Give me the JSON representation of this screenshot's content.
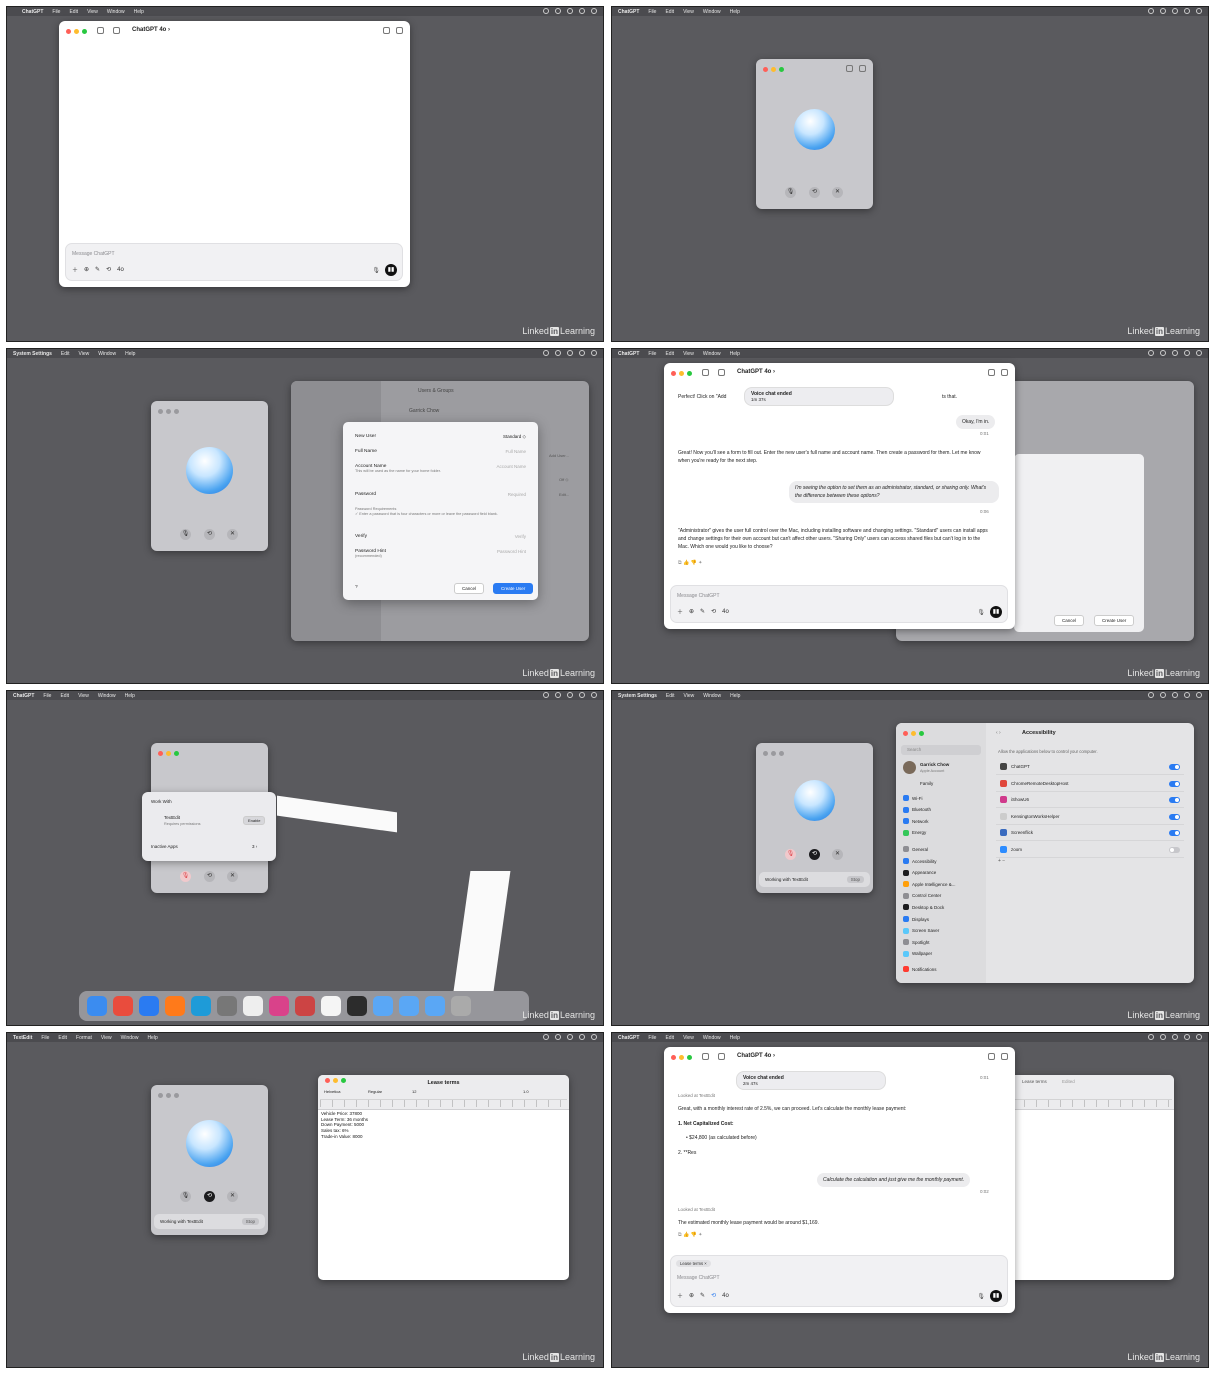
{
  "menubar": {
    "chatgpt": {
      "app": "ChatGPT",
      "items": [
        "File",
        "Edit",
        "View",
        "Window",
        "Help"
      ]
    },
    "settings": {
      "app": "System Settings",
      "items": [
        "Edit",
        "View",
        "Window",
        "Help"
      ]
    },
    "textedit": {
      "app": "TextEdit",
      "items": [
        "File",
        "Edit",
        "Format",
        "View",
        "Window",
        "Help"
      ]
    }
  },
  "watermark": {
    "brand": "Linked",
    "in": "in",
    "suffix": "Learning"
  },
  "chat": {
    "title": "ChatGPT 4o ›",
    "placeholder": "Message ChatGPT",
    "model_badge": "4o"
  },
  "frame4": {
    "toast_title": "Voice chat ended",
    "toast_time": "1m 37s",
    "msg1": "Perfect! Click on \"Add",
    "msg1_tail": "ts that.",
    "user1": "Okay, I'm in.",
    "user1_time": "0:01",
    "msg2": "Great! Now you'll see a form to fill out. Enter the new user's full name and account name. Then create a password for them. Let me know when you're ready for the next step.",
    "user2": "I'm seeing the option to set them as an administrator, standard, or sharing only. What's the difference between these options?",
    "user2_time": "0:06",
    "msg3": "\"Administrator\" gives the user full control over the Mac, including installing software and changing settings. \"Standard\" users can install apps and change settings for their own account but can't affect other users. \"Sharing Only\" users can access shared files but can't log in to the Mac. Which one would you like to choose?"
  },
  "new_user_form": {
    "header": "Users & Groups",
    "user_name": "Garrick Chow",
    "new_user_label": "New User",
    "new_user_value": "Standard ◇",
    "full_name_label": "Full Name",
    "full_name_ph": "Full Name",
    "account_label": "Account Name",
    "account_sub": "This will be used as the name for your home folder.",
    "account_ph": "Account Name",
    "password_label": "Password",
    "password_ph": "Required",
    "requirements_label": "Password Requirements",
    "requirements_text": "✓ Enter a password that is four characters or more or leave the password field blank.",
    "verify_label": "Verify",
    "verify_ph": "Verify",
    "hint_label": "Password Hint",
    "hint_sub": "(recommended)",
    "hint_ph": "Password Hint",
    "help": "?",
    "cancel": "Cancel",
    "create": "Create User",
    "add_user": "Add User...",
    "off": "Off ◇",
    "edit": "Edit..."
  },
  "work_with": {
    "title": "Work With",
    "app": "TextEdit",
    "app_sub": "Requires permissions",
    "enable": "Enable",
    "inactive": "Inactive Apps",
    "inactive_count": "3 ›"
  },
  "accessibility": {
    "title": "Accessibility",
    "search": "Search",
    "account_name": "Garrick Chow",
    "account_sub": "Apple Account",
    "family": "Family",
    "description": "Allow the applications below to control your computer.",
    "sidebar": [
      {
        "label": "Wi-Fi",
        "color": "#2a7bf2"
      },
      {
        "label": "Bluetooth",
        "color": "#2a7bf2"
      },
      {
        "label": "Network",
        "color": "#2a7bf2"
      },
      {
        "label": "Energy",
        "color": "#34c759"
      },
      {
        "label": "General",
        "color": "#8e8e93"
      },
      {
        "label": "Accessibility",
        "color": "#2a7bf2"
      },
      {
        "label": "Appearance",
        "color": "#1c1c1e"
      },
      {
        "label": "Apple Intelligence &...",
        "color": "#ff9f0a"
      },
      {
        "label": "Control Center",
        "color": "#8e8e93"
      },
      {
        "label": "Desktop & Dock",
        "color": "#1c1c1e"
      },
      {
        "label": "Displays",
        "color": "#2a7bf2"
      },
      {
        "label": "Screen Saver",
        "color": "#5ac8fa"
      },
      {
        "label": "Spotlight",
        "color": "#8e8e93"
      },
      {
        "label": "Wallpaper",
        "color": "#5ac8fa"
      },
      {
        "label": "Notifications",
        "color": "#ff3b30"
      }
    ],
    "apps": [
      {
        "name": "ChatGPT",
        "on": true,
        "color": "#444"
      },
      {
        "name": "ChromeRemoteDesktopHost",
        "on": true,
        "color": "#e0473c"
      },
      {
        "name": "iShowU6",
        "on": true,
        "color": "#d03a8c"
      },
      {
        "name": "KensingtonWorksHelper",
        "on": true,
        "color": "#ccc"
      },
      {
        "name": "Screenflick",
        "on": true,
        "color": "#3a6bbf"
      },
      {
        "name": "zoom",
        "on": false,
        "color": "#2d8cff"
      }
    ],
    "plus_minus": "+ −",
    "working_label": "Working with TextEdit",
    "stop": "Stop"
  },
  "textedit": {
    "title": "Lease terms",
    "font": "Helvetica",
    "style": "Regular",
    "size": "12",
    "spacing": "1.0",
    "lines": [
      "Vehicle Price: 37800",
      "Lease Term: 36 months",
      "Down Payment: 5000",
      "Sales tax: 6%",
      "Trade-in Value: 8000"
    ],
    "edited": "Edited"
  },
  "frame8": {
    "toast_title": "Voice chat ended",
    "toast_time": "2m 47s",
    "time_top": "0:01",
    "looked1": "Looked at TextEdit",
    "msg1": "Great, with a monthly interest rate of 2.5%, we can proceed. Let's calculate the monthly lease payment:",
    "item1": "1.  Net Capitalized Cost:",
    "bullet1": "•  $24,800 (as calculated before)",
    "item2": "2.  **Res",
    "user": "Calculate the calculation and just give me the monthly payment.",
    "user_time": "0:02",
    "looked2": "Looked at TextEdit",
    "msg2": "The estimated monthly lease payment would be around $1,169.",
    "attachment": "Lease terms ×"
  }
}
